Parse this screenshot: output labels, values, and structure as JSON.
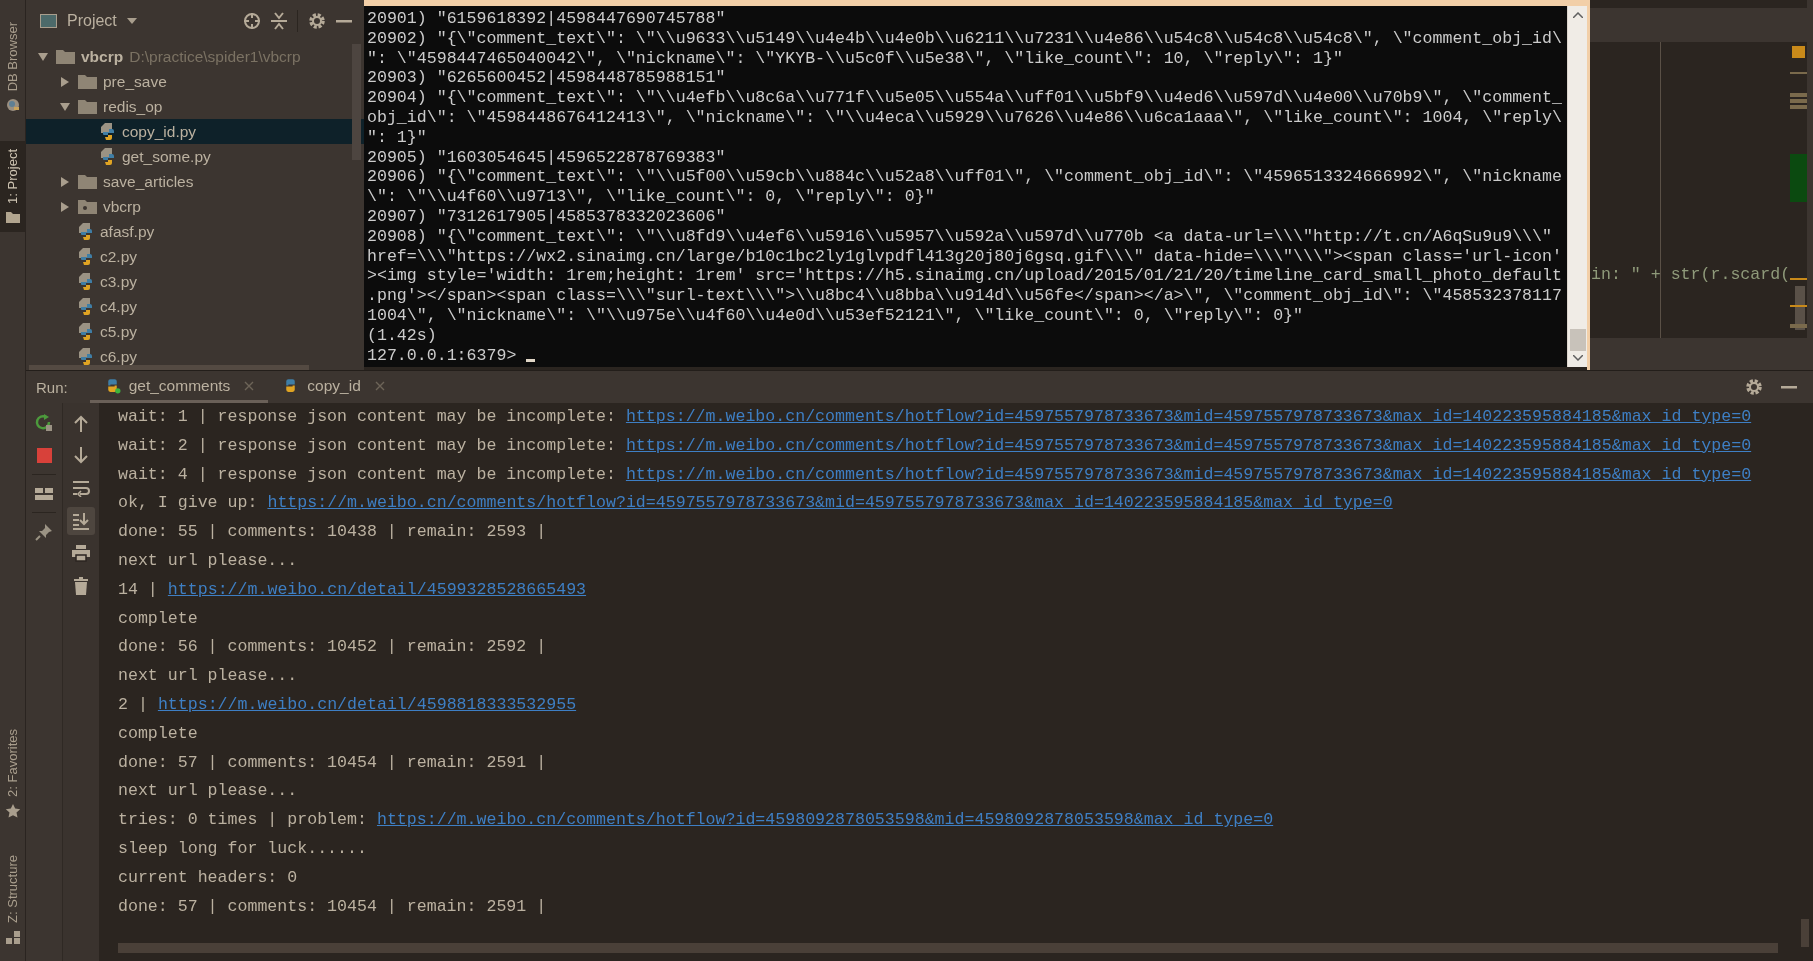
{
  "tool_strip_left": {
    "top": [
      {
        "label": "DB Browser",
        "kind": "database",
        "selected": false
      },
      {
        "label": "1: Project",
        "kind": "project",
        "selected": true
      }
    ],
    "bottom": [
      {
        "label": "2: Favorites",
        "kind": "favorites",
        "selected": false
      },
      {
        "label": "Z: Structure",
        "kind": "structure",
        "selected": false
      }
    ]
  },
  "project": {
    "title": "Project",
    "tree": [
      {
        "name": "vbcrp",
        "path": "D:\\practice\\spider1\\vbcrp",
        "kind": "folder",
        "expanded": true,
        "selected": false,
        "children": [
          {
            "name": "pre_save",
            "kind": "folder",
            "expanded": false,
            "selected": false
          },
          {
            "name": "redis_op",
            "kind": "folder",
            "expanded": true,
            "selected": false,
            "children": [
              {
                "name": "copy_id.py",
                "kind": "python",
                "selected": true
              },
              {
                "name": "get_some.py",
                "kind": "python",
                "selected": false
              }
            ]
          },
          {
            "name": "save_articles",
            "kind": "folder",
            "expanded": false,
            "selected": false
          },
          {
            "name": "vbcrp",
            "kind": "package",
            "expanded": false,
            "selected": false
          },
          {
            "name": "afasf.py",
            "kind": "python",
            "selected": false
          },
          {
            "name": "c2.py",
            "kind": "python",
            "selected": false
          },
          {
            "name": "c3.py",
            "kind": "python",
            "selected": false
          },
          {
            "name": "c4.py",
            "kind": "python",
            "selected": false
          },
          {
            "name": "c5.py",
            "kind": "python",
            "selected": false
          },
          {
            "name": "c6.py",
            "kind": "python",
            "selected": false
          }
        ]
      }
    ]
  },
  "terminal": {
    "lines": [
      "20901) \"6159618392|4598447690745788\"",
      "20902) \"{\\\"comment_text\\\": \\\"\\\\u9633\\\\u5149\\\\u4e4b\\\\u4e0b\\\\u6211\\\\u7231\\\\u4e86\\\\u54c8\\\\u54c8\\\\u54c8\\\", \\\"comment_obj_id\\",
      "\": \\\"4598447465040042\\\", \\\"nickname\\\": \\\"YKYB-\\\\u5c0f\\\\u5e38\\\", \\\"like_count\\\": 10, \\\"reply\\\": 1}\"",
      "20903) \"6265600452|4598448785988151\"",
      "20904) \"{\\\"comment_text\\\": \\\"\\\\u4efb\\\\u8c6a\\\\u771f\\\\u5e05\\\\u554a\\\\uff01\\\\u5bf9\\\\u4ed6\\\\u597d\\\\u4e00\\\\u70b9\\\", \\\"comment_",
      "obj_id\\\": \\\"4598448676412413\\\", \\\"nickname\\\": \\\"\\\\u4eca\\\\u5929\\\\u7626\\\\u4e86\\\\u6ca1aaa\\\", \\\"like_count\\\": 1004, \\\"reply\\",
      "\": 1}\"",
      "20905) \"1603054645|4596522878769383\"",
      "20906) \"{\\\"comment_text\\\": \\\"\\\\u5f00\\\\u59cb\\\\u884c\\\\u52a8\\\\uff01\\\", \\\"comment_obj_id\\\": \\\"4596513324666992\\\", \\\"nickname",
      "\\\": \\\"\\\\u4f60\\\\u9713\\\", \\\"like_count\\\": 0, \\\"reply\\\": 0}\"",
      "20907) \"7312617905|4585378332023606\"",
      "20908) \"{\\\"comment_text\\\": \\\"\\\\u8fd9\\\\u4ef6\\\\u5916\\\\u5957\\\\u592a\\\\u597d\\\\u770b <a data-url=\\\\\\\"http://t.cn/A6qSu9u9\\\\\\\"",
      "href=\\\\\\\"https://wx2.sinaimg.cn/large/b10c1bc2ly1glvpdfl413g20j80j6gsq.gif\\\\\\\" data-hide=\\\\\\\"\\\\\\\"><span class='url-icon'",
      "><img style='width: 1rem;height: 1rem' src='https://h5.sinaimg.cn/upload/2015/01/21/20/timeline_card_small_photo_default",
      ".png'></span><span class=\\\\\\\"surl-text\\\\\\\">\\\\u8bc4\\\\u8bba\\\\u914d\\\\u56fe</span></a>\\\", \\\"comment_obj_id\\\": \\\"458532378117",
      "1004\\\", \\\"nickname\\\": \\\"\\\\u975e\\\\u4f60\\\\u4e0d\\\\u53ef52121\\\", \\\"like_count\\\": 0, \\\"reply\\\": 0}\"",
      "(1.42s)"
    ],
    "prompt": "127.0.0.1:6379>"
  },
  "editor": {
    "code_fragment": "in: \" + str(r.scard("
  },
  "run": {
    "label": "Run:",
    "tabs": [
      {
        "label": "get_comments",
        "selected": true
      },
      {
        "label": "copy_id",
        "selected": false
      }
    ],
    "scroll_to_end_on": true,
    "lines": [
      {
        "text": "wait: 1 | response json content may be incomplete:",
        "link": "https://m.weibo.cn/comments/hotflow?id=4597557978733673&mid=4597557978733673&max_id=140223595884185&max_id_type=0"
      },
      {
        "text": "wait: 2 | response json content may be incomplete:",
        "link": "https://m.weibo.cn/comments/hotflow?id=4597557978733673&mid=4597557978733673&max_id=140223595884185&max_id_type=0"
      },
      {
        "text": "wait: 4 | response json content may be incomplete:",
        "link": "https://m.weibo.cn/comments/hotflow?id=4597557978733673&mid=4597557978733673&max_id=140223595884185&max_id_type=0"
      },
      {
        "text": "ok, I give up:",
        "link": "https://m.weibo.cn/comments/hotflow?id=4597557978733673&mid=4597557978733673&max_id=140223595884185&max_id_type=0"
      },
      {
        "text": "done: 55 | comments: 10438 | remain: 2593 |"
      },
      {
        "text": "next url please..."
      },
      {
        "text": "14 |",
        "link": "https://m.weibo.cn/detail/4599328528665493"
      },
      {
        "text": "complete"
      },
      {
        "text": "done: 56 | comments: 10452 | remain: 2592 |"
      },
      {
        "text": "next url please..."
      },
      {
        "text": "2 |",
        "link": "https://m.weibo.cn/detail/4598818333532955"
      },
      {
        "text": "complete"
      },
      {
        "text": "done: 57 | comments: 10454 | remain: 2591 |"
      },
      {
        "text": "next url please..."
      },
      {
        "text": "tries: 0 times | problem:",
        "link": "https://m.weibo.cn/comments/hotflow?id=4598092878053598&mid=4598092878053598&max_id_type=0"
      },
      {
        "text": "sleep long for luck......"
      },
      {
        "text": "current headers: 0"
      },
      {
        "text": "done: 57 | comments: 10454 | remain: 2591 |"
      }
    ]
  }
}
